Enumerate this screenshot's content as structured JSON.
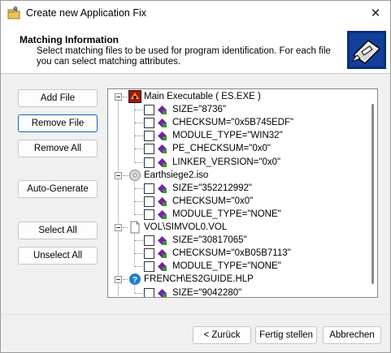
{
  "window": {
    "title": "Create new Application Fix",
    "close_glyph": "✕",
    "app_icon": "wrench-folder-icon"
  },
  "header": {
    "title": "Matching Information",
    "description": "Select matching files to be used for program identification. For each file you can select matching attributes.",
    "logo_icon": "wizard-logo-icon"
  },
  "buttons": {
    "add_file": "Add File",
    "remove_file": "Remove File",
    "remove_all": "Remove All",
    "auto_generate": "Auto-Generate",
    "select_all": "Select All",
    "unselect_all": "Unselect All"
  },
  "footer": {
    "back": "< Zurück",
    "finish": "Fertig stellen",
    "cancel": "Abbrechen"
  },
  "tree": {
    "files": [
      {
        "name": "Main Executable ( ES.EXE )",
        "icon": "executable-icon",
        "attributes": [
          "SIZE=\"8736\"",
          "CHECKSUM=\"0x5B745EDF\"",
          "MODULE_TYPE=\"WIN32\"",
          "PE_CHECKSUM=\"0x0\"",
          "LINKER_VERSION=\"0x0\""
        ]
      },
      {
        "name": "Earthsiege2.iso",
        "icon": "disc-image-icon",
        "attributes": [
          "SIZE=\"352212992\"",
          "CHECKSUM=\"0x0\"",
          "MODULE_TYPE=\"NONE\""
        ]
      },
      {
        "name": "VOL\\SIMVOL0.VOL",
        "icon": "file-icon",
        "attributes": [
          "SIZE=\"30817065\"",
          "CHECKSUM=\"0xB05B7113\"",
          "MODULE_TYPE=\"NONE\""
        ]
      },
      {
        "name": "FRENCH\\ES2GUIDE.HLP",
        "icon": "help-file-icon",
        "attributes": [
          "SIZE=\"9042280\""
        ]
      }
    ]
  },
  "colors": {
    "focus_border": "#0a64c8",
    "attr_icon_purple": "#7a1fa2",
    "attr_icon_green": "#2e9a2e",
    "help_icon_blue": "#1e7fd8"
  }
}
